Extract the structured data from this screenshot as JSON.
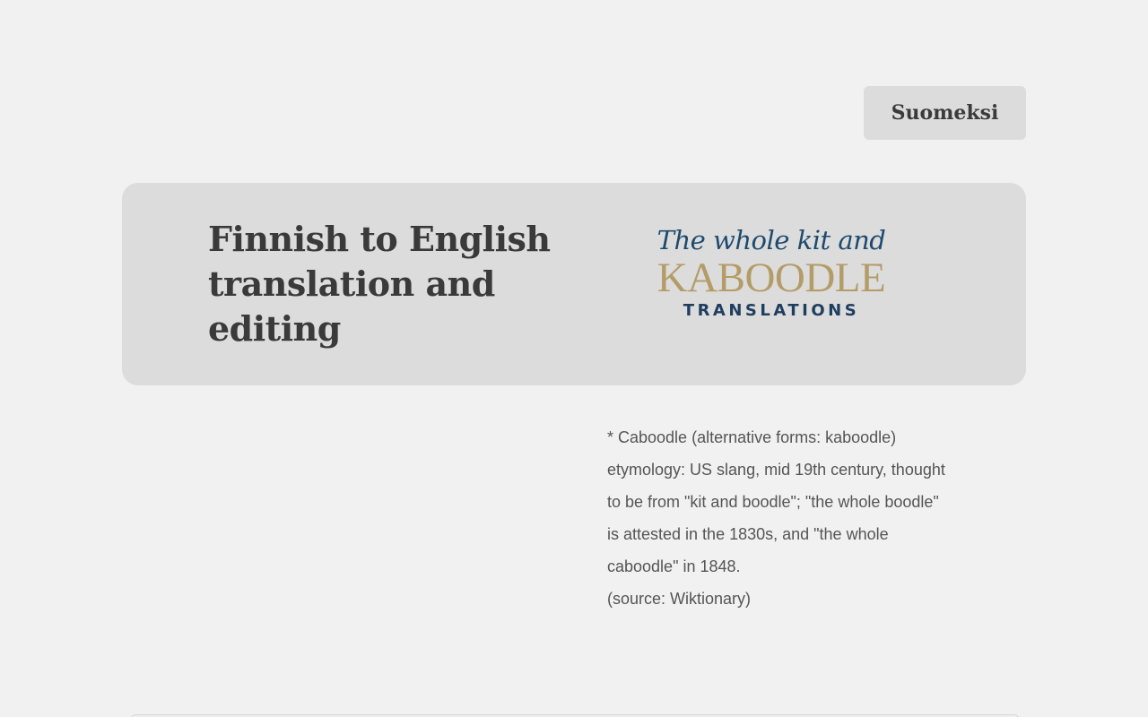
{
  "language_switch": {
    "label": "Suomeksi"
  },
  "hero": {
    "title": "Finnish to English translation and editing"
  },
  "logo": {
    "line1": "The whole kit and",
    "line2": "KABOODLE",
    "line3": "TRANSLATIONS"
  },
  "etymology": {
    "text": "* Caboodle (alternative forms: kaboodle) etymology: US slang, mid 19th century, thought to be from \"kit and boodle\"; \"the whole boodle\" is attested in the 1830s, and \"the whole caboodle\" in 1848.",
    "source": "(source: Wiktionary)"
  },
  "colors": {
    "background": "#f1f1f1",
    "panel": "#dcdcdc",
    "text_dark": "#3a3a3a",
    "logo_navy": "#1f4a6e",
    "logo_gold": "#b49c68"
  }
}
